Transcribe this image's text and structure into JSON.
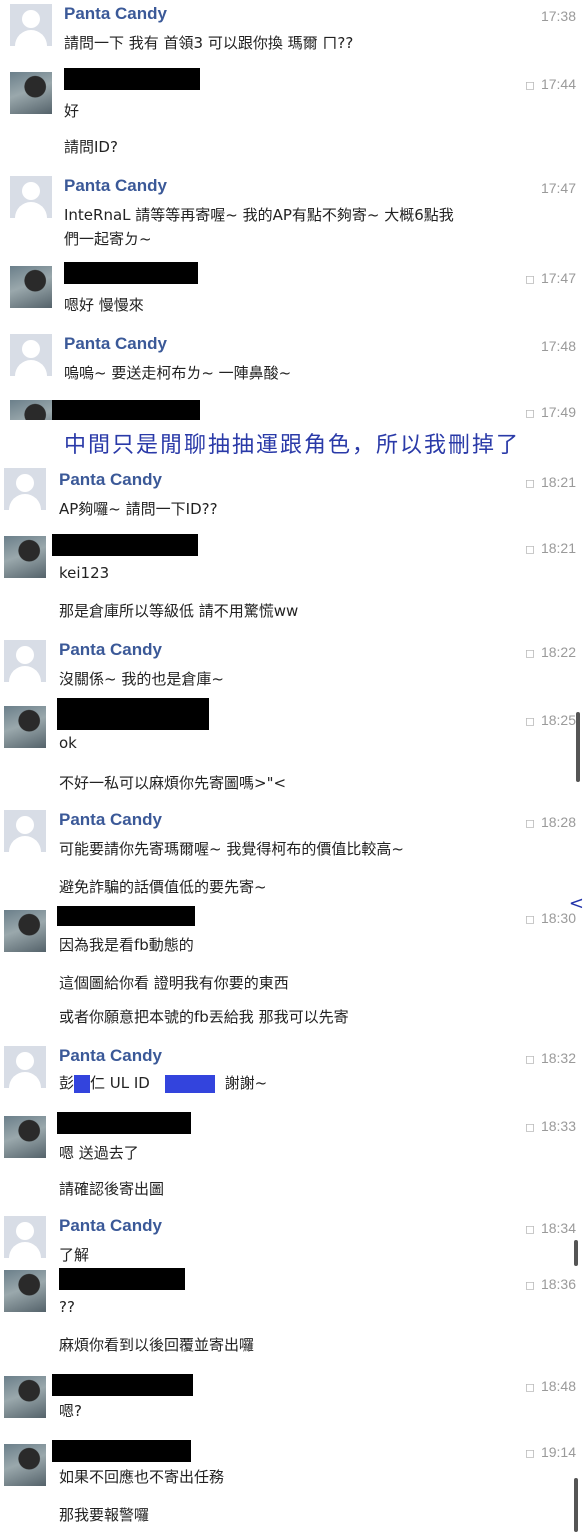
{
  "separator": "中間只是閒聊抽抽運跟角色，所以我刪掉了",
  "reply_icon": "reply-icon",
  "partner_name": "Panta Candy",
  "messages": [
    {
      "time": "17:38",
      "lines": [
        "請問一下 我有 首領3 可以跟你換 瑪爾 ㄇ??"
      ]
    },
    {
      "time": "17:44",
      "lines": [
        "好",
        "請問ID?"
      ]
    },
    {
      "time": "17:47",
      "lines": [
        "InteRnaL 請等等再寄喔~ 我的AP有點不夠寄~ 大概6點我",
        "們一起寄ㄉ~"
      ]
    },
    {
      "time": "17:47",
      "lines": [
        "嗯好 慢慢來"
      ]
    },
    {
      "time": "17:48",
      "lines": [
        "嗚嗚~ 要送走柯布ㄌ~ 一陣鼻酸~"
      ]
    },
    {
      "time": "17:49",
      "lines": []
    },
    {
      "time": "18:21",
      "lines": [
        "AP夠囉~ 請問一下ID??"
      ]
    },
    {
      "time": "18:21",
      "lines": [
        "kei123",
        "那是倉庫所以等級低 請不用驚慌ww"
      ]
    },
    {
      "time": "18:22",
      "lines": [
        "沒關係~ 我的也是倉庫~"
      ]
    },
    {
      "time": "18:25",
      "lines": [
        "ok",
        "不好一私可以麻煩你先寄圖嗎>\"<"
      ]
    },
    {
      "time": "18:28",
      "lines": [
        "可能要請你先寄瑪爾喔~ 我覺得柯布的價值比較高~",
        "避免詐騙的話價值低的要先寄~"
      ]
    },
    {
      "time": "18:30",
      "lines": [
        "因為我是看fb動態的",
        "這個圖給你看 證明我有你要的東西",
        "或者你願意把本號的fb丟給我 那我可以先寄"
      ]
    },
    {
      "time": "18:32",
      "lines": [
        "彭",
        "仁 UL ID",
        "謝謝~"
      ]
    },
    {
      "time": "18:33",
      "lines": [
        "嗯 送過去了",
        "請確認後寄出圖"
      ]
    },
    {
      "time": "18:34",
      "lines": [
        "了解"
      ]
    },
    {
      "time": "18:36",
      "lines": [
        "??",
        "麻煩你看到以後回覆並寄出囉"
      ]
    },
    {
      "time": "18:48",
      "lines": [
        "嗯?"
      ]
    },
    {
      "time": "19:14",
      "lines": [
        "如果不回應也不寄出任務",
        "那我要報警囉"
      ]
    }
  ]
}
